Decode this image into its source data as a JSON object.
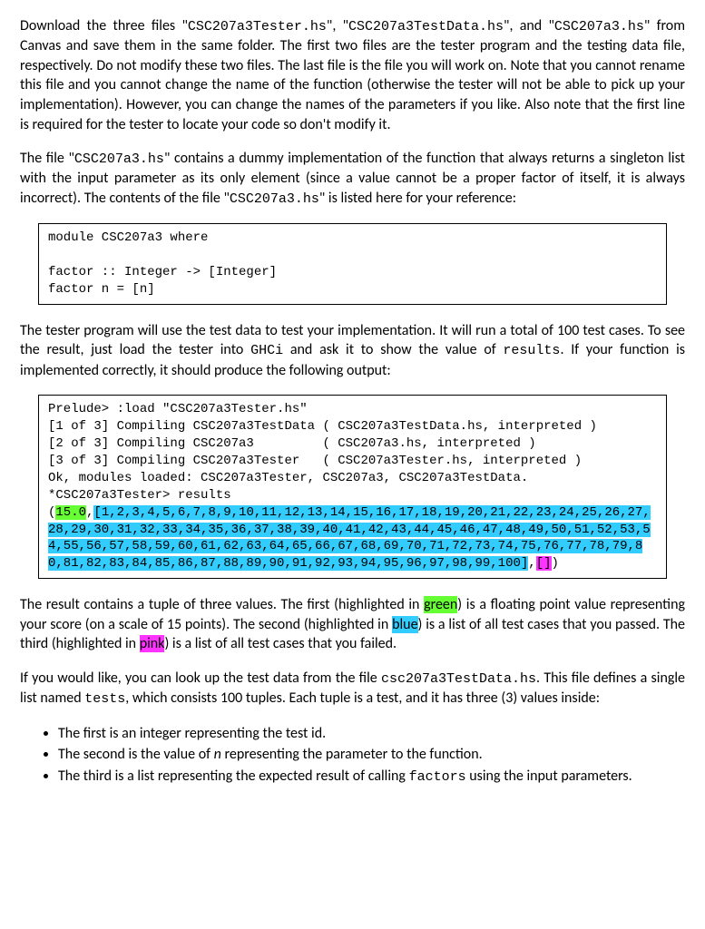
{
  "para1_pre": "Download the three files \"",
  "file1": "CSC207a3Tester.hs",
  "para1_mid1": "\", \"",
  "file2": "CSC207a3TestData.hs",
  "para1_mid2": "\", and \"",
  "file3": "CSC207a3.hs",
  "para1_post": "\" from Canvas and save them in the same folder. The first two files are the tester program and the testing data file, respectively. Do not modify these two files. The last file is the file you will work on. Note that you cannot rename this file and you cannot change the name of the function (otherwise the tester will not be able to pick up your implementation). However, you can change the names of the parameters if you like. Also note that the first line is required for the tester to locate your code so don't modify it.",
  "para2_pre": "The file \"",
  "para2_file1": "CSC207a3.hs",
  "para2_mid": "\" contains a dummy implementation of the function that always returns a singleton list with the input parameter as its only element (since a value cannot be a proper factor of itself, it is always incorrect). The contents of the file \"",
  "para2_file2": "CSC207a3.hs",
  "para2_post": "\" is listed here for your reference:",
  "codebox1": "module CSC207a3 where\n\nfactor :: Integer -> [Integer]\nfactor n = [n]",
  "para3_pre": "The tester program will use the test data to test your implementation. It will run a total of 100 test cases. To see the result, just load the tester into ",
  "para3_ghci": "GHCi",
  "para3_mid": " and ask it to show the value of ",
  "para3_results": "results",
  "para3_post": ". If your function is implemented correctly, it should produce the following output:",
  "out_line1": "Prelude> :load \"CSC207a3Tester.hs\"",
  "out_line2": "[1 of 3] Compiling CSC207a3TestData ( CSC207a3TestData.hs, interpreted )",
  "out_line3": "[2 of 3] Compiling CSC207a3         ( CSC207a3.hs, interpreted )",
  "out_line4": "[3 of 3] Compiling CSC207a3Tester   ( CSC207a3Tester.hs, interpreted )",
  "out_line5": "Ok, modules loaded: CSC207a3Tester, CSC207a3, CSC207a3TestData.",
  "out_line6": "*CSC207a3Tester> results",
  "out_open": "(",
  "out_score": "15.0",
  "out_sep1": ",",
  "out_passlist": "[1,2,3,4,5,6,7,8,9,10,11,12,13,14,15,16,17,18,19,20,21,22,23,24,25,26,27,28,29,30,31,32,33,34,35,36,37,38,39,40,41,42,43,44,45,46,47,48,49,50,51,52,53,54,55,56,57,58,59,60,61,62,63,64,65,66,67,68,69,70,71,72,73,74,75,76,77,78,79,80,81,82,83,84,85,86,87,88,89,90,91,92,93,94,95,96,97,98,99,100]",
  "out_sep2": ",",
  "out_faillist": "[]",
  "out_close": ")",
  "para4_pre": "The result contains a tuple of three values. The first (highlighted in ",
  "para4_green": "green",
  "para4_mid1": ") is a floating point value representing your score (on a scale of 15 points). The second (highlighted in ",
  "para4_blue": "blue",
  "para4_mid2": ") is a list of all test cases that you passed. The third (highlighted in ",
  "para4_pink": "pink",
  "para4_post": ") is a list of all test cases that you failed.",
  "para5_pre": "If you would like, you can look up the test data from the file ",
  "para5_file": "csc207a3TestData.hs",
  "para5_mid": ". This file defines a single list named ",
  "para5_tests": "tests",
  "para5_post": ", which consists 100 tuples. Each tuple is a test, and it has three (3) values inside:",
  "bullet1": "The first is an integer representing the test id.",
  "bullet2_pre": "The second is the value of ",
  "bullet2_n": "n",
  "bullet2_post": " representing the parameter to the function.",
  "bullet3_pre": "The third is a list representing the expected result of calling ",
  "bullet3_fn": "factors",
  "bullet3_post": " using the input parameters."
}
